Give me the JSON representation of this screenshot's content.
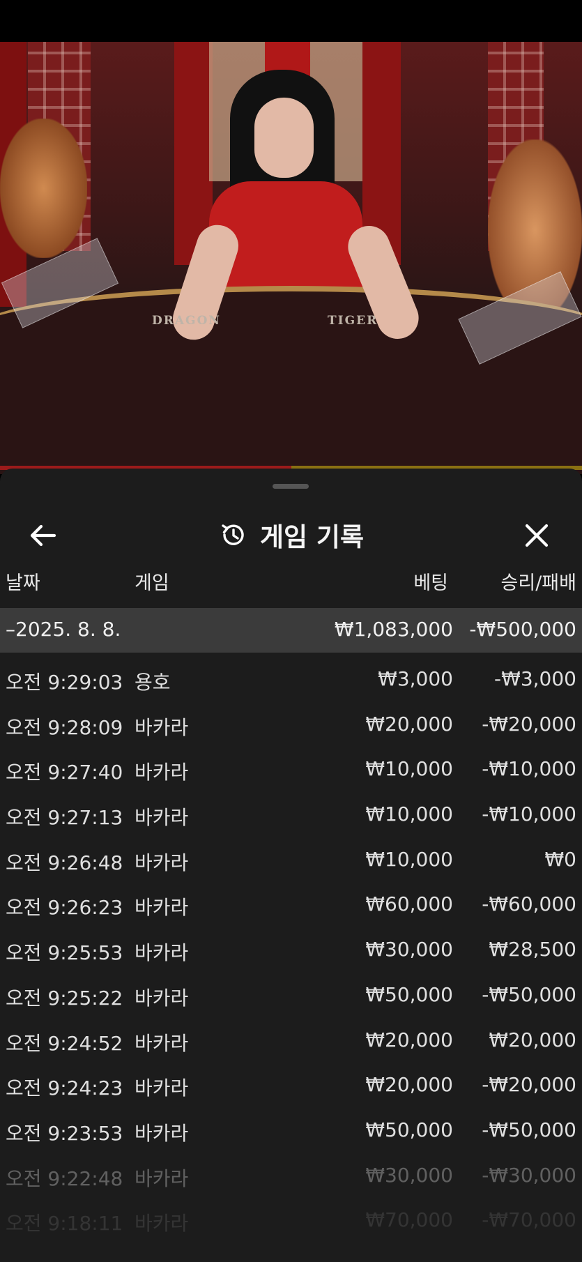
{
  "video": {
    "table_labels": [
      "DRAGON",
      "TIGER"
    ],
    "progress": 0.5
  },
  "history": {
    "title": "게임 기록",
    "icons": {
      "back": "arrow-left-icon",
      "title": "history-icon",
      "close": "close-icon"
    },
    "columns": {
      "date": "날짜",
      "game": "게임",
      "bet": "베팅",
      "result": "승리/패배"
    },
    "group": {
      "label": "–2025. 8. 8.",
      "bet": "₩1,083,000",
      "result": "-₩500,000"
    },
    "rows": [
      {
        "time": "오전 9:29:03",
        "game": "용호",
        "bet": "₩3,000",
        "result": "-₩3,000"
      },
      {
        "time": "오전 9:28:09",
        "game": "바카라",
        "bet": "₩20,000",
        "result": "-₩20,000"
      },
      {
        "time": "오전 9:27:40",
        "game": "바카라",
        "bet": "₩10,000",
        "result": "-₩10,000"
      },
      {
        "time": "오전 9:27:13",
        "game": "바카라",
        "bet": "₩10,000",
        "result": "-₩10,000"
      },
      {
        "time": "오전 9:26:48",
        "game": "바카라",
        "bet": "₩10,000",
        "result": "₩0"
      },
      {
        "time": "오전 9:26:23",
        "game": "바카라",
        "bet": "₩60,000",
        "result": "-₩60,000"
      },
      {
        "time": "오전 9:25:53",
        "game": "바카라",
        "bet": "₩30,000",
        "result": "₩28,500"
      },
      {
        "time": "오전 9:25:22",
        "game": "바카라",
        "bet": "₩50,000",
        "result": "-₩50,000"
      },
      {
        "time": "오전 9:24:52",
        "game": "바카라",
        "bet": "₩20,000",
        "result": "₩20,000"
      },
      {
        "time": "오전 9:24:23",
        "game": "바카라",
        "bet": "₩20,000",
        "result": "-₩20,000"
      },
      {
        "time": "오전 9:23:53",
        "game": "바카라",
        "bet": "₩50,000",
        "result": "-₩50,000"
      },
      {
        "time": "오전 9:22:48",
        "game": "바카라",
        "bet": "₩30,000",
        "result": "-₩30,000"
      },
      {
        "time": "오전 9:18:11",
        "game": "바카라",
        "bet": "₩70,000",
        "result": "-₩70,000"
      }
    ]
  }
}
